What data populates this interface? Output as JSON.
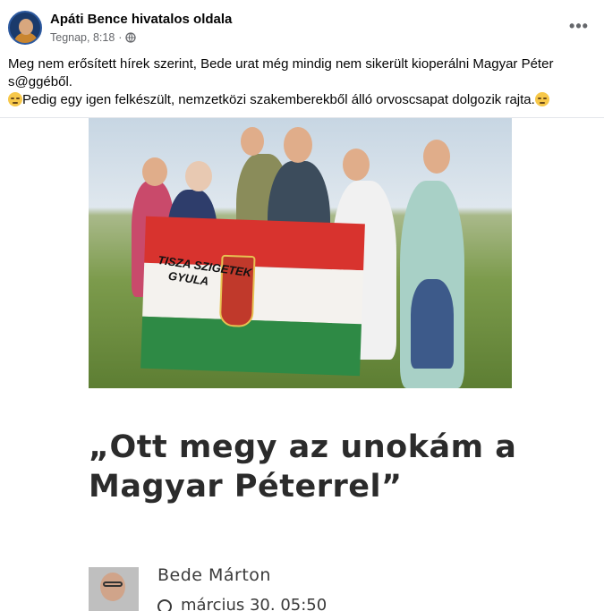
{
  "post": {
    "page_name": "Apáti Bence hivatalos oldala",
    "time": "Tegnap, 8:18",
    "separator": "·",
    "privacy_icon": "globe-icon",
    "more_icon": "more-horizontal-icon",
    "text_line1": "Meg nem erősített hírek szerint, Bede urat még mindig nem sikerült kioperálni Magyar Péter s@ggéből.",
    "text_line2": "Pedig egy igen felkészült, nemzetközi szakemberekből álló orvoscsapat dolgozik rajta.",
    "emoji_icon": "downcast-face-emoji"
  },
  "shared": {
    "flag_text_line1": "TISZA SZIGETEK",
    "flag_text_line2": "GYULA",
    "headline_line1": "„Ott megy az unokám a",
    "headline_line2": "Magyar Péterrel”",
    "author_name": "Bede Márton",
    "author_date_partial": "március 30. 05:50"
  },
  "colors": {
    "accent": "#050505",
    "meta": "#65676b",
    "divider": "#e4e6eb",
    "flag_red": "#d8332e",
    "flag_white": "#f4f2ee",
    "flag_green": "#2e8a45"
  }
}
